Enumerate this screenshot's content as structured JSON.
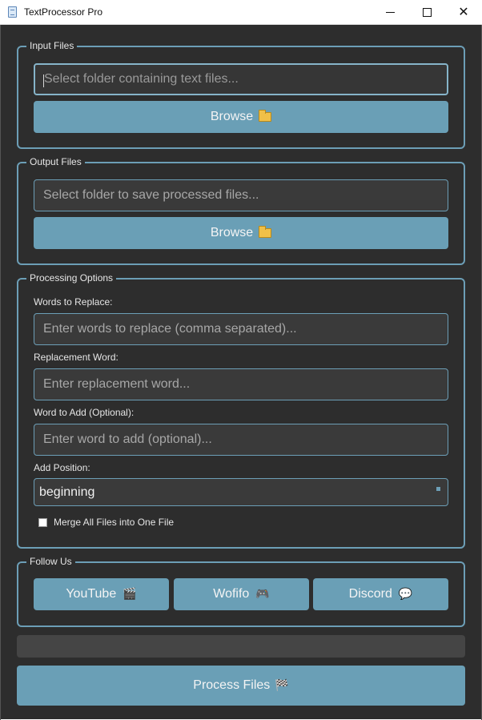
{
  "window": {
    "title": "TextProcessor Pro"
  },
  "input_files": {
    "label": "Input Files",
    "placeholder": "Select folder containing text files...",
    "browse_label": "Browse",
    "browse_icon": "folder-icon"
  },
  "output_files": {
    "label": "Output Files",
    "placeholder": "Select folder to save processed files...",
    "browse_label": "Browse",
    "browse_icon": "folder-icon"
  },
  "processing": {
    "label": "Processing Options",
    "words_to_replace": {
      "label": "Words to Replace:",
      "placeholder": "Enter words to replace (comma separated)..."
    },
    "replacement_word": {
      "label": "Replacement Word:",
      "placeholder": "Enter replacement word..."
    },
    "word_to_add": {
      "label": "Word to Add (Optional):",
      "placeholder": "Enter word to add (optional)..."
    },
    "add_position": {
      "label": "Add Position:",
      "value": "beginning"
    },
    "merge": {
      "label": "Merge All Files into One File",
      "checked": false
    }
  },
  "follow_us": {
    "label": "Follow Us",
    "buttons": [
      {
        "label": "YouTube",
        "icon": "clapper-icon",
        "glyph": "🎬"
      },
      {
        "label": "Wofifo",
        "icon": "gamepad-icon",
        "glyph": "🎮"
      },
      {
        "label": "Discord",
        "icon": "speech-bubble-icon",
        "glyph": "💬"
      }
    ]
  },
  "progress": {
    "value": 0
  },
  "process_button": {
    "label": "Process Files",
    "icon": "checkered-flag-icon",
    "glyph": "🏁"
  },
  "colors": {
    "accent": "#6a9fb6",
    "background": "#2d2d2d",
    "field": "#3a3a3a",
    "text": "#e6e6e6"
  }
}
